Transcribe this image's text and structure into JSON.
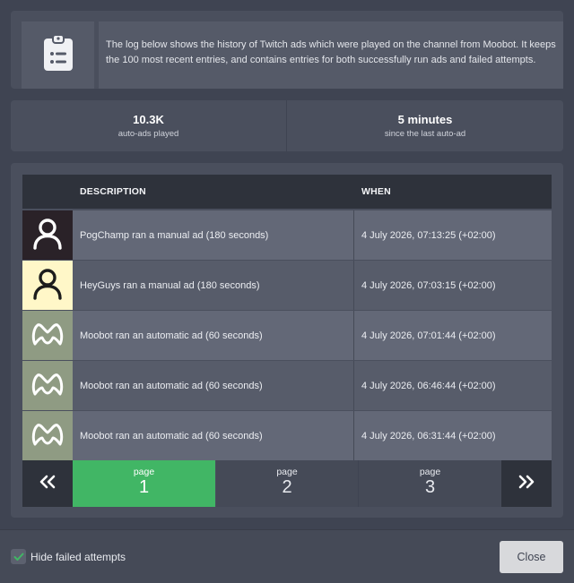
{
  "info": {
    "icon": "clipboard-list-icon",
    "text": "The log below shows the history of Twitch ads which were played on the channel from Moobot. It keeps the 100 most recent entries, and contains entries for both successfully run ads and failed attempts."
  },
  "stats": [
    {
      "value": "10.3K",
      "label": "auto-ads played"
    },
    {
      "value": "5 minutes",
      "label": "since the last auto-ad"
    }
  ],
  "table": {
    "headers": {
      "avatar": "",
      "description": "DESCRIPTION",
      "when": "WHEN"
    },
    "rows": [
      {
        "avatar": "user-avatar-icon",
        "avatar_bg": "#2a2228",
        "avatar_fg": "#ffffff",
        "description": "PogChamp ran a manual ad (180 seconds)",
        "when": "4 July 2026, 07:13:25 (+02:00)"
      },
      {
        "avatar": "user-avatar-icon",
        "avatar_bg": "#fff7c8",
        "avatar_fg": "#1c1c1c",
        "description": "HeyGuys ran a manual ad (180 seconds)",
        "when": "4 July 2026, 07:03:15 (+02:00)"
      },
      {
        "avatar": "moobot-logo-icon",
        "avatar_bg": "#8f9b83",
        "avatar_fg": "#ffffff",
        "description": "Moobot ran an automatic ad (60 seconds)",
        "when": "4 July 2026, 07:01:44 (+02:00)"
      },
      {
        "avatar": "moobot-logo-icon",
        "avatar_bg": "#8f9b83",
        "avatar_fg": "#ffffff",
        "description": "Moobot ran an automatic ad (60 seconds)",
        "when": "4 July 2026, 06:46:44 (+02:00)"
      },
      {
        "avatar": "moobot-logo-icon",
        "avatar_bg": "#8f9b83",
        "avatar_fg": "#ffffff",
        "description": "Moobot ran an automatic ad (60 seconds)",
        "when": "4 July 2026, 06:31:44 (+02:00)"
      }
    ]
  },
  "pagination": {
    "prev_icon": "double-chevron-left-icon",
    "next_icon": "double-chevron-right-icon",
    "pages": [
      {
        "label": "page",
        "number": "1",
        "active": true
      },
      {
        "label": "page",
        "number": "2",
        "active": false
      },
      {
        "label": "page",
        "number": "3",
        "active": false
      }
    ]
  },
  "footer": {
    "hide_failed_label": "Hide failed attempts",
    "hide_failed_checked": true,
    "close_label": "Close"
  },
  "colors": {
    "background": "#3f4452",
    "panel": "#4a4f5d",
    "active_page": "#41b665",
    "header": "#2e323b",
    "checkmark": "#41b665"
  }
}
